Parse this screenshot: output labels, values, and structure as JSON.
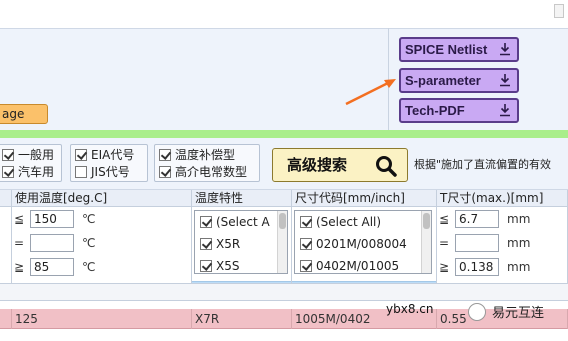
{
  "top": {
    "page_tag_label": "age",
    "side_buttons": [
      {
        "label": "SPICE Netlist",
        "icon": "download-icon"
      },
      {
        "label": "S-parameter",
        "icon": "download-icon"
      },
      {
        "label": "Tech-PDF",
        "icon": "download-icon"
      }
    ],
    "annotation_color": "#f36f21"
  },
  "filters": {
    "group1": [
      "一般用",
      "汽车用"
    ],
    "group2": [
      "EIA代号",
      "JIS代号"
    ],
    "group3": [
      "温度补偿型",
      "高介电常数型"
    ],
    "group1_checked": [
      true,
      true
    ],
    "group2_checked": [
      true,
      false
    ],
    "group3_checked": [
      true,
      true
    ],
    "search_label": "高级搜索",
    "note": "根据\"施加了直流偏置的有效"
  },
  "table": {
    "headers": [
      "使用温度[deg.C]",
      "温度特性",
      "尺寸代码[mm/inch]",
      "T尺寸(max.)[mm]"
    ],
    "temp": {
      "rows": [
        {
          "op": "≦",
          "value": "150",
          "unit": "℃"
        },
        {
          "op": "=",
          "value": "",
          "unit": "℃"
        },
        {
          "op": "≧",
          "value": "85",
          "unit": "℃"
        }
      ]
    },
    "temp_char_options": [
      {
        "label": "(Select A",
        "checked": true
      },
      {
        "label": "X5R",
        "checked": true
      },
      {
        "label": "X5S",
        "checked": true
      }
    ],
    "size_options": [
      {
        "label": "(Select All)",
        "checked": true
      },
      {
        "label": "0201M/008004",
        "checked": true
      },
      {
        "label": "0402M/01005",
        "checked": true
      }
    ],
    "tsize": {
      "rows": [
        {
          "op": "≦",
          "value": "6.7",
          "unit": "mm"
        },
        {
          "op": "=",
          "value": "",
          "unit": "mm"
        },
        {
          "op": "≧",
          "value": "0.138",
          "unit": "mm"
        }
      ]
    },
    "data_row": [
      "125",
      "X7R",
      "1005M/0402",
      "0.55"
    ]
  },
  "watermark": {
    "site": "ybx8.cn",
    "brand": "易元互连"
  },
  "colors": {
    "accent_purple": "#c9a9f3",
    "green_bar": "#a9ee8b",
    "highlight_row": "#f1c0c6",
    "search_button": "#fbf2c4",
    "tag_orange": "#fbc16a"
  }
}
